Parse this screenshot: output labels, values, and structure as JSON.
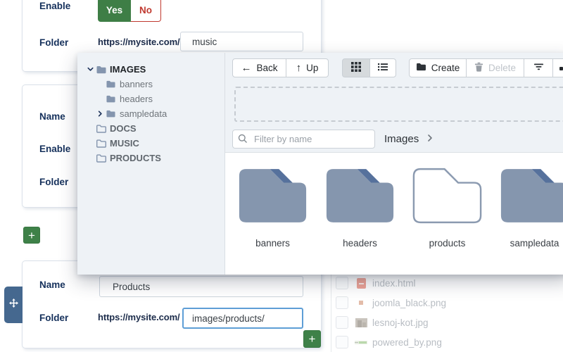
{
  "forms": {
    "url_prefix": "https://mysite.com/",
    "add_label": "+",
    "section_top": {
      "enable_label": "Enable",
      "yes_label": "Yes",
      "no_label": "No",
      "folder_label": "Folder",
      "folder_value": "music"
    },
    "section_middle": {
      "name_label": "Name",
      "enable_label": "Enable",
      "folder_label": "Folder"
    },
    "section_bottom": {
      "name_label": "Name",
      "name_value": "Products",
      "folder_label": "Folder",
      "folder_value": "images/products/"
    }
  },
  "modal": {
    "tree": {
      "items": [
        {
          "label": "IMAGES",
          "level": 0,
          "state": "expanded",
          "icon": "folder-filled"
        },
        {
          "label": "banners",
          "level": 1,
          "icon": "folder-filled"
        },
        {
          "label": "headers",
          "level": 1,
          "icon": "folder-filled"
        },
        {
          "label": "sampledata",
          "level": 1,
          "state": "collapsed",
          "icon": "folder-filled"
        },
        {
          "label": "DOCS",
          "level": 0,
          "icon": "folder-outline"
        },
        {
          "label": "MUSIC",
          "level": 0,
          "icon": "folder-outline"
        },
        {
          "label": "PRODUCTS",
          "level": 0,
          "icon": "folder-outline"
        }
      ]
    },
    "toolbar": {
      "back_label": "Back",
      "up_label": "Up",
      "create_label": "Create",
      "delete_label": "Delete"
    },
    "search": {
      "placeholder": "Filter by name"
    },
    "breadcrumb": {
      "current": "Images"
    },
    "folders": [
      {
        "name": "banners",
        "style": "filled"
      },
      {
        "name": "headers",
        "style": "filled"
      },
      {
        "name": "products",
        "style": "outline"
      },
      {
        "name": "sampledata",
        "style": "filled"
      }
    ]
  },
  "background_list": {
    "files": [
      {
        "name": "index.html"
      },
      {
        "name": "joomla_black.png"
      },
      {
        "name": "lesnoj-kot.jpg"
      },
      {
        "name": "powered_by.png"
      }
    ]
  },
  "colors": {
    "accent_green": "#3e8148",
    "danger_red": "#c0392f",
    "label_navy": "#15305b",
    "folder_fill": "#8596ae",
    "folder_fold": "#56719c",
    "handle_blue": "#45688f",
    "modal_panel_bg": "#eef2f6"
  }
}
